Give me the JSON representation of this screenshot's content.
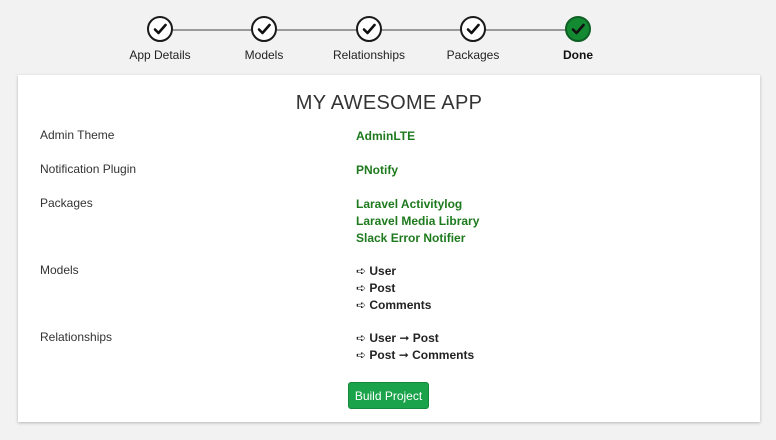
{
  "stepper": {
    "steps": [
      {
        "label": "App Details",
        "state": "complete"
      },
      {
        "label": "Models",
        "state": "complete"
      },
      {
        "label": "Relationships",
        "state": "complete"
      },
      {
        "label": "Packages",
        "state": "complete"
      },
      {
        "label": "Done",
        "state": "current"
      }
    ]
  },
  "summary": {
    "title": "MY AWESOME APP",
    "rows": [
      {
        "key": "Admin Theme",
        "values": [
          "AdminLTE"
        ]
      },
      {
        "key": "Notification Plugin",
        "values": [
          "PNotify"
        ]
      },
      {
        "key": "Packages",
        "values": [
          "Laravel Activitylog",
          "Laravel Media Library",
          "Slack Error Notifier"
        ]
      },
      {
        "key": "Models",
        "values": [
          "➪ User",
          "➪ Post",
          "➪ Comments"
        ]
      },
      {
        "key": "Relationships",
        "values": [
          "➪ User ➞ Post",
          "➪ Post ➞ Comments"
        ]
      }
    ]
  },
  "actions": {
    "build_label": "Build Project"
  },
  "colors": {
    "accent_green": "#1aa34a",
    "value_green": "#1d7a1d",
    "done_step": "#138a32"
  },
  "icons": {
    "step_icon": "check-circle-icon"
  }
}
